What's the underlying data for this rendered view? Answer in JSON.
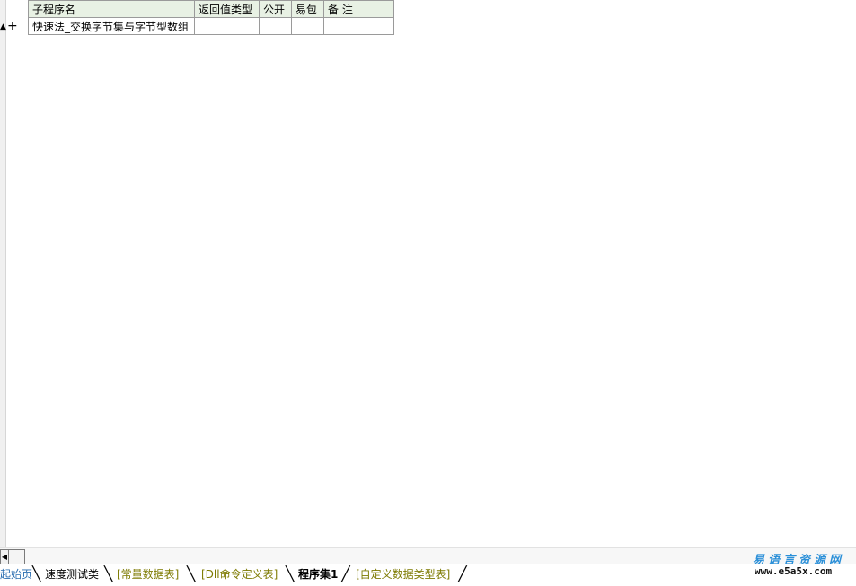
{
  "table": {
    "headers": [
      "子程序名",
      "返回值类型",
      "公开",
      "易包",
      "备 注"
    ],
    "rows": [
      [
        "快速法_交换字节集与字节型数组",
        "",
        "",
        "",
        ""
      ]
    ]
  },
  "row_marker": {
    "expand_symbol": "+"
  },
  "tabs": [
    {
      "label": "起始页"
    },
    {
      "label": "速度测试类"
    },
    {
      "label": "[常量数据表]"
    },
    {
      "label": "[Dll命令定义表]"
    },
    {
      "label": "程序集1"
    },
    {
      "label": "[自定义数据类型表]"
    }
  ],
  "watermark": {
    "title": "易语言资源网",
    "url": "www.e5a5x.com"
  },
  "colors": {
    "header_bg": "#e8f1e4",
    "tab_blue": "#2a6db0",
    "tab_olive": "#7d7a00",
    "watermark_blue": "#2a8fd8"
  }
}
